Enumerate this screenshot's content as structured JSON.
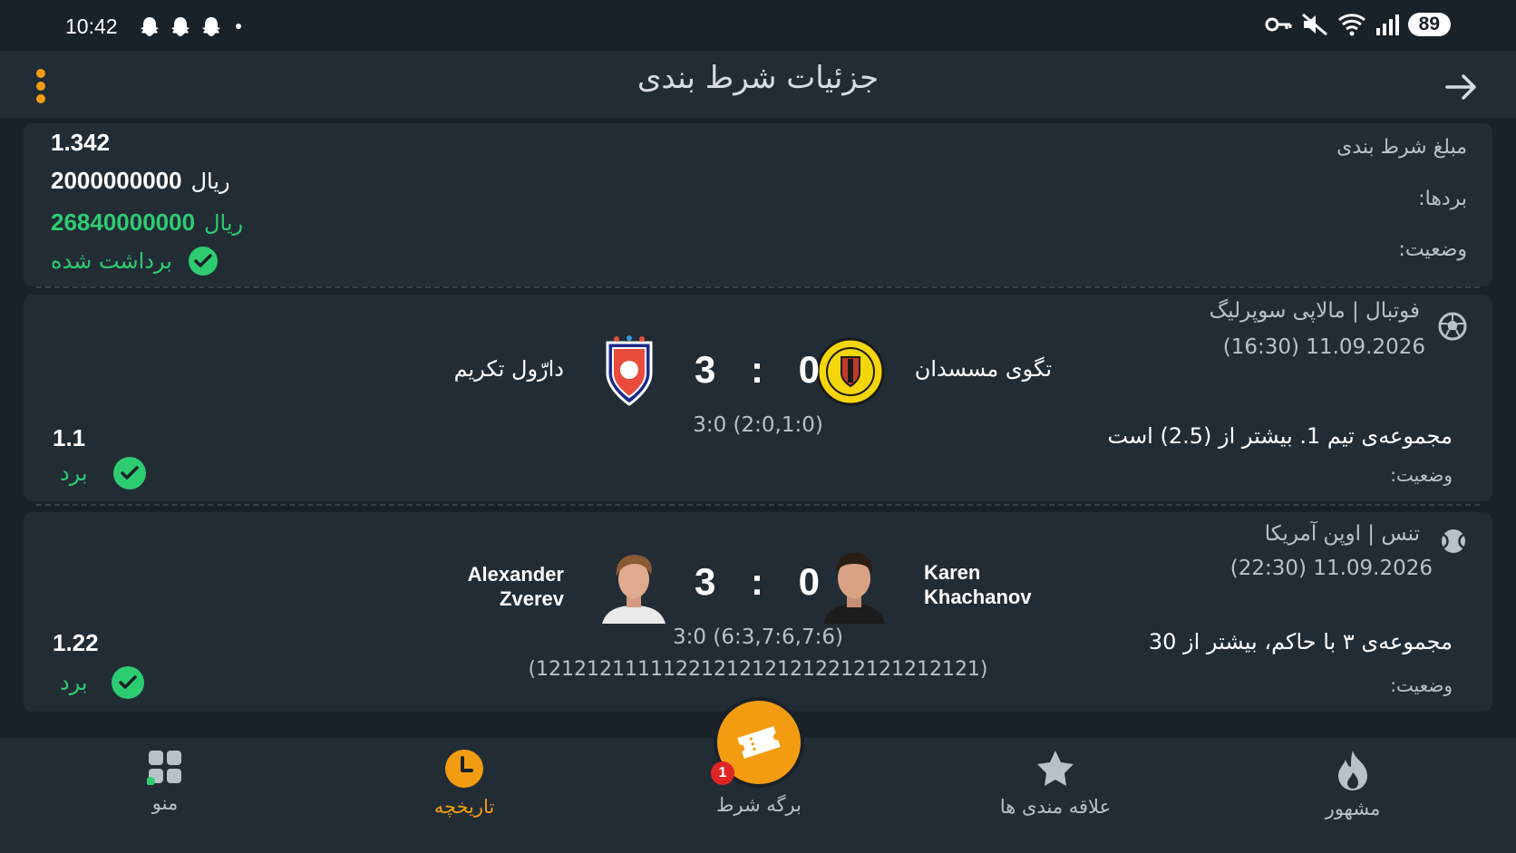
{
  "status_bar": {
    "time": "10:42",
    "battery": "89",
    "icons": [
      "snapchat-ghost-icon",
      "snapchat-ghost-icon",
      "snapchat-ghost-icon",
      "dot-icon",
      "vpn-key-icon",
      "mute-icon",
      "wifi-icon",
      "signal-icon"
    ]
  },
  "header": {
    "title": "جزئیات شرط بندی",
    "back_icon": "arrow-right-icon",
    "menu_icon": "more-vertical-icon"
  },
  "summary": {
    "odds": "1.342",
    "stake_label": "مبلغ شرط بندی",
    "stake_value": "2000000000",
    "currency": "ریال",
    "winnings_label": "بردها:",
    "winnings_value": "26840000000",
    "status_label": "وضعیت:",
    "status_value": "برداشت شده"
  },
  "matches": [
    {
      "sport_icon": "soccer-ball-icon",
      "league": "فوتبال | مالاپی سوپرلیگ",
      "datetime": "(16:30) 11.09.2026",
      "home_team": "تگوی مسسدان",
      "away_team": "دارّول تکریم",
      "home_score": "0",
      "away_score": "3",
      "score_separator": ":",
      "score_detail": "3:0 (2:0,1:0)",
      "market": "مجموعه‌ی تیم 1. بیشتر از (2.5) است",
      "status_label": "وضعیت:",
      "odds": "1.1",
      "result": "برد"
    },
    {
      "sport_icon": "tennis-ball-icon",
      "league": "تنس | اوپن آمریکا",
      "datetime": "(22:30) 11.09.2026",
      "home_player_first": "Karen",
      "home_player_last": "Khachanov",
      "away_player_first": "Alexander",
      "away_player_last": "Zverev",
      "home_score": "0",
      "away_score": "3",
      "score_separator": ":",
      "score_detail": "3:0 (6:3,7:6,7:6)",
      "point_sequence": "(12121211111221212121212212121212121)",
      "market": "مجموعه‌ی ۳ با حاکم، بیشتر از 30",
      "status_label": "وضعیت:",
      "odds": "1.22",
      "result": "برد"
    }
  ],
  "bottom_nav": {
    "items": [
      {
        "label": "منو",
        "icon": "grid-icon"
      },
      {
        "label": "تاریخچه",
        "icon": "clock-icon"
      },
      {
        "label": "برگه شرط",
        "icon": "ticket-icon",
        "badge": "1"
      },
      {
        "label": "علاقه مندی ها",
        "icon": "star-icon"
      },
      {
        "label": "مشهور",
        "icon": "flame-icon"
      }
    ]
  },
  "colors": {
    "accent": "#f39c12",
    "success": "#2ecc71",
    "background": "#1a2229",
    "card": "#222c35"
  }
}
